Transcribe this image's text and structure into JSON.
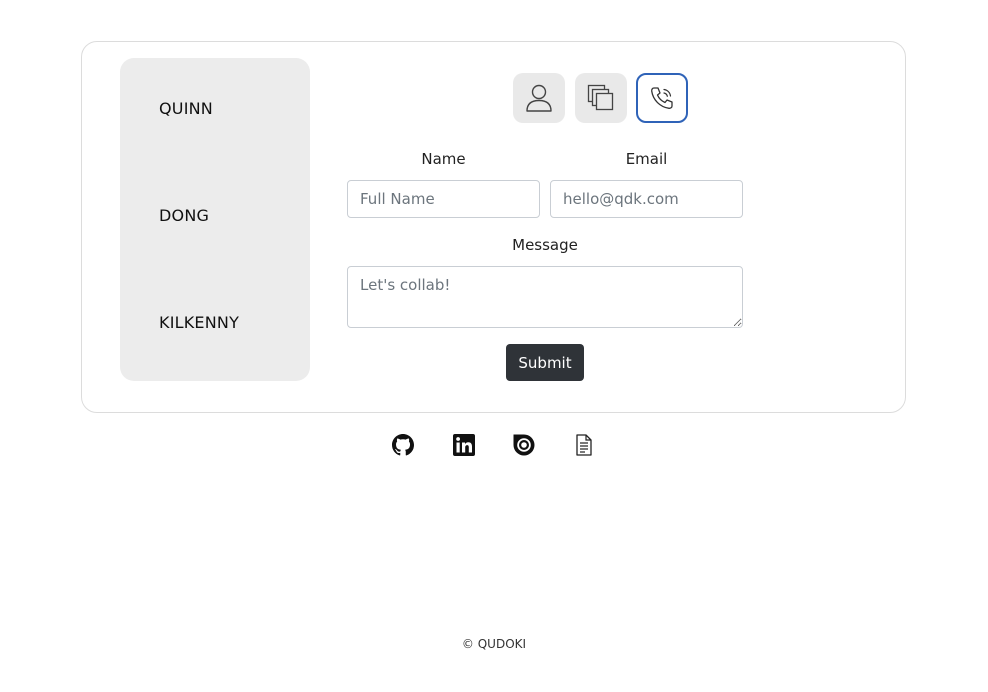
{
  "name_panel": {
    "words": [
      "QUINN",
      "DONG",
      "KILKENNY"
    ]
  },
  "tabs": [
    {
      "icon": "person-icon",
      "active": false
    },
    {
      "icon": "copy-icon",
      "active": false
    },
    {
      "icon": "telephone-icon",
      "active": true
    }
  ],
  "form": {
    "name_label": "Name",
    "name_placeholder": "Full Name",
    "email_label": "Email",
    "email_placeholder": "hello@qdk.com",
    "message_label": "Message",
    "message_placeholder": "Let's collab!",
    "submit_label": "Submit"
  },
  "social_links": [
    {
      "icon": "github-icon"
    },
    {
      "icon": "linkedin-icon"
    },
    {
      "icon": "issuu-icon"
    },
    {
      "icon": "resume-document-icon"
    }
  ],
  "footer": {
    "copyright": "© QUDOKI"
  },
  "colors": {
    "panel_bg": "#ececec",
    "active_tab_border": "#2f63b8",
    "button_bg": "#2f3338"
  }
}
